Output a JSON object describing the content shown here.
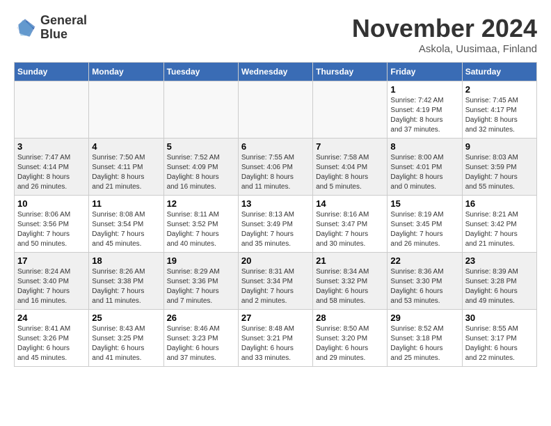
{
  "header": {
    "logo_line1": "General",
    "logo_line2": "Blue",
    "month_year": "November 2024",
    "location": "Askola, Uusimaa, Finland"
  },
  "weekdays": [
    "Sunday",
    "Monday",
    "Tuesday",
    "Wednesday",
    "Thursday",
    "Friday",
    "Saturday"
  ],
  "weeks": [
    [
      {
        "day": "",
        "info": ""
      },
      {
        "day": "",
        "info": ""
      },
      {
        "day": "",
        "info": ""
      },
      {
        "day": "",
        "info": ""
      },
      {
        "day": "",
        "info": ""
      },
      {
        "day": "1",
        "info": "Sunrise: 7:42 AM\nSunset: 4:19 PM\nDaylight: 8 hours\nand 37 minutes."
      },
      {
        "day": "2",
        "info": "Sunrise: 7:45 AM\nSunset: 4:17 PM\nDaylight: 8 hours\nand 32 minutes."
      }
    ],
    [
      {
        "day": "3",
        "info": "Sunrise: 7:47 AM\nSunset: 4:14 PM\nDaylight: 8 hours\nand 26 minutes."
      },
      {
        "day": "4",
        "info": "Sunrise: 7:50 AM\nSunset: 4:11 PM\nDaylight: 8 hours\nand 21 minutes."
      },
      {
        "day": "5",
        "info": "Sunrise: 7:52 AM\nSunset: 4:09 PM\nDaylight: 8 hours\nand 16 minutes."
      },
      {
        "day": "6",
        "info": "Sunrise: 7:55 AM\nSunset: 4:06 PM\nDaylight: 8 hours\nand 11 minutes."
      },
      {
        "day": "7",
        "info": "Sunrise: 7:58 AM\nSunset: 4:04 PM\nDaylight: 8 hours\nand 5 minutes."
      },
      {
        "day": "8",
        "info": "Sunrise: 8:00 AM\nSunset: 4:01 PM\nDaylight: 8 hours\nand 0 minutes."
      },
      {
        "day": "9",
        "info": "Sunrise: 8:03 AM\nSunset: 3:59 PM\nDaylight: 7 hours\nand 55 minutes."
      }
    ],
    [
      {
        "day": "10",
        "info": "Sunrise: 8:06 AM\nSunset: 3:56 PM\nDaylight: 7 hours\nand 50 minutes."
      },
      {
        "day": "11",
        "info": "Sunrise: 8:08 AM\nSunset: 3:54 PM\nDaylight: 7 hours\nand 45 minutes."
      },
      {
        "day": "12",
        "info": "Sunrise: 8:11 AM\nSunset: 3:52 PM\nDaylight: 7 hours\nand 40 minutes."
      },
      {
        "day": "13",
        "info": "Sunrise: 8:13 AM\nSunset: 3:49 PM\nDaylight: 7 hours\nand 35 minutes."
      },
      {
        "day": "14",
        "info": "Sunrise: 8:16 AM\nSunset: 3:47 PM\nDaylight: 7 hours\nand 30 minutes."
      },
      {
        "day": "15",
        "info": "Sunrise: 8:19 AM\nSunset: 3:45 PM\nDaylight: 7 hours\nand 26 minutes."
      },
      {
        "day": "16",
        "info": "Sunrise: 8:21 AM\nSunset: 3:42 PM\nDaylight: 7 hours\nand 21 minutes."
      }
    ],
    [
      {
        "day": "17",
        "info": "Sunrise: 8:24 AM\nSunset: 3:40 PM\nDaylight: 7 hours\nand 16 minutes."
      },
      {
        "day": "18",
        "info": "Sunrise: 8:26 AM\nSunset: 3:38 PM\nDaylight: 7 hours\nand 11 minutes."
      },
      {
        "day": "19",
        "info": "Sunrise: 8:29 AM\nSunset: 3:36 PM\nDaylight: 7 hours\nand 7 minutes."
      },
      {
        "day": "20",
        "info": "Sunrise: 8:31 AM\nSunset: 3:34 PM\nDaylight: 7 hours\nand 2 minutes."
      },
      {
        "day": "21",
        "info": "Sunrise: 8:34 AM\nSunset: 3:32 PM\nDaylight: 6 hours\nand 58 minutes."
      },
      {
        "day": "22",
        "info": "Sunrise: 8:36 AM\nSunset: 3:30 PM\nDaylight: 6 hours\nand 53 minutes."
      },
      {
        "day": "23",
        "info": "Sunrise: 8:39 AM\nSunset: 3:28 PM\nDaylight: 6 hours\nand 49 minutes."
      }
    ],
    [
      {
        "day": "24",
        "info": "Sunrise: 8:41 AM\nSunset: 3:26 PM\nDaylight: 6 hours\nand 45 minutes."
      },
      {
        "day": "25",
        "info": "Sunrise: 8:43 AM\nSunset: 3:25 PM\nDaylight: 6 hours\nand 41 minutes."
      },
      {
        "day": "26",
        "info": "Sunrise: 8:46 AM\nSunset: 3:23 PM\nDaylight: 6 hours\nand 37 minutes."
      },
      {
        "day": "27",
        "info": "Sunrise: 8:48 AM\nSunset: 3:21 PM\nDaylight: 6 hours\nand 33 minutes."
      },
      {
        "day": "28",
        "info": "Sunrise: 8:50 AM\nSunset: 3:20 PM\nDaylight: 6 hours\nand 29 minutes."
      },
      {
        "day": "29",
        "info": "Sunrise: 8:52 AM\nSunset: 3:18 PM\nDaylight: 6 hours\nand 25 minutes."
      },
      {
        "day": "30",
        "info": "Sunrise: 8:55 AM\nSunset: 3:17 PM\nDaylight: 6 hours\nand 22 minutes."
      }
    ]
  ]
}
